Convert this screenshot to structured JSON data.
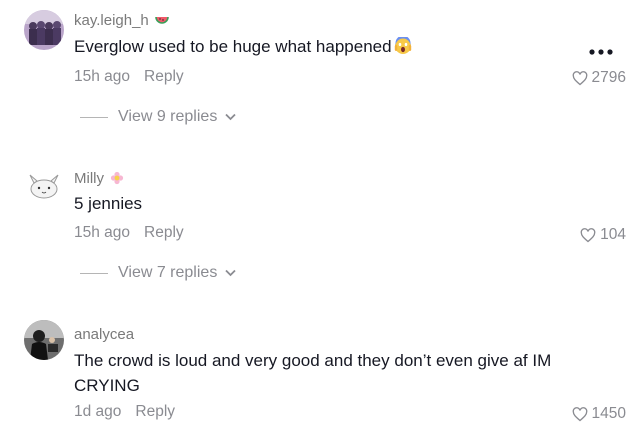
{
  "comments": [
    {
      "username": "kay.leigh_h",
      "username_emoji": "watermelon-icon",
      "text": "Everglow used to be huge what happened",
      "text_emoji": "screaming-face-icon",
      "time": "15h ago",
      "reply_label": "Reply",
      "likes": "2796",
      "view_replies": "View 9 replies"
    },
    {
      "username": "Milly",
      "username_emoji": "flower-icon",
      "text": "5 jennies",
      "time": "15h ago",
      "reply_label": "Reply",
      "likes": "104",
      "view_replies": "View 7 replies"
    },
    {
      "username": "analycea",
      "text": "The crowd is loud and very good and they don’t even give af IM CRYING",
      "time": "1d ago",
      "reply_label": "Reply",
      "likes": "1450"
    }
  ],
  "more_options_icon": "more-horizontal-icon"
}
